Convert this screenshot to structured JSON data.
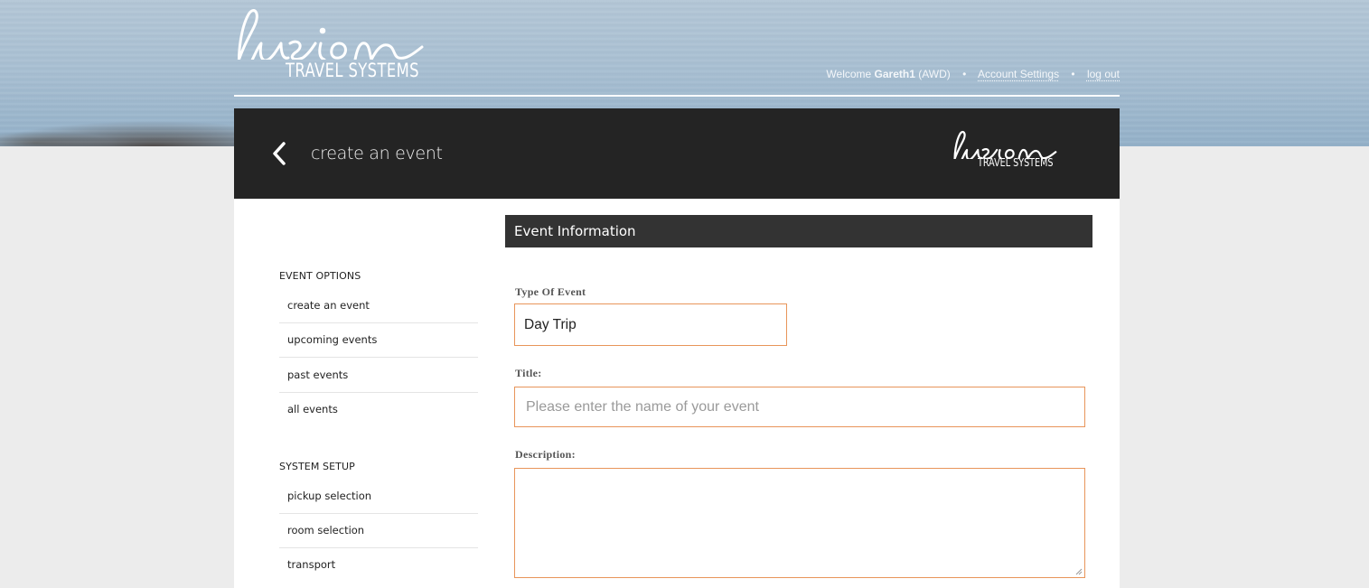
{
  "header": {
    "logo_word": "fusion",
    "logo_sub": "TRAVEL SYSTEMS",
    "welcome_prefix": "Welcome",
    "username": "Gareth1",
    "org": "(AWD)",
    "account_settings": "Account Settings",
    "logout": "log out",
    "separator": "•"
  },
  "titlebar": {
    "title": "create an event",
    "logo_sub": "TRAVEL SYSTEMS"
  },
  "sidebar": {
    "event_options_heading": "EVENT OPTIONS",
    "event_options": [
      {
        "label": "create an event"
      },
      {
        "label": "upcoming events"
      },
      {
        "label": "past events"
      },
      {
        "label": "all events"
      }
    ],
    "system_setup_heading": "SYSTEM SETUP",
    "system_setup": [
      {
        "label": "pickup selection"
      },
      {
        "label": "room selection"
      },
      {
        "label": "transport"
      }
    ]
  },
  "form": {
    "section_title": "Event Information",
    "type_label": "Type Of Event",
    "type_value": "Day Trip",
    "title_label": "Title:",
    "title_placeholder": "Please enter the name of your event",
    "title_value": "",
    "description_label": "Description:",
    "description_value": ""
  },
  "colors": {
    "accent_border": "#e8955a",
    "dark_bar": "#242424",
    "section_bar": "#333333"
  }
}
